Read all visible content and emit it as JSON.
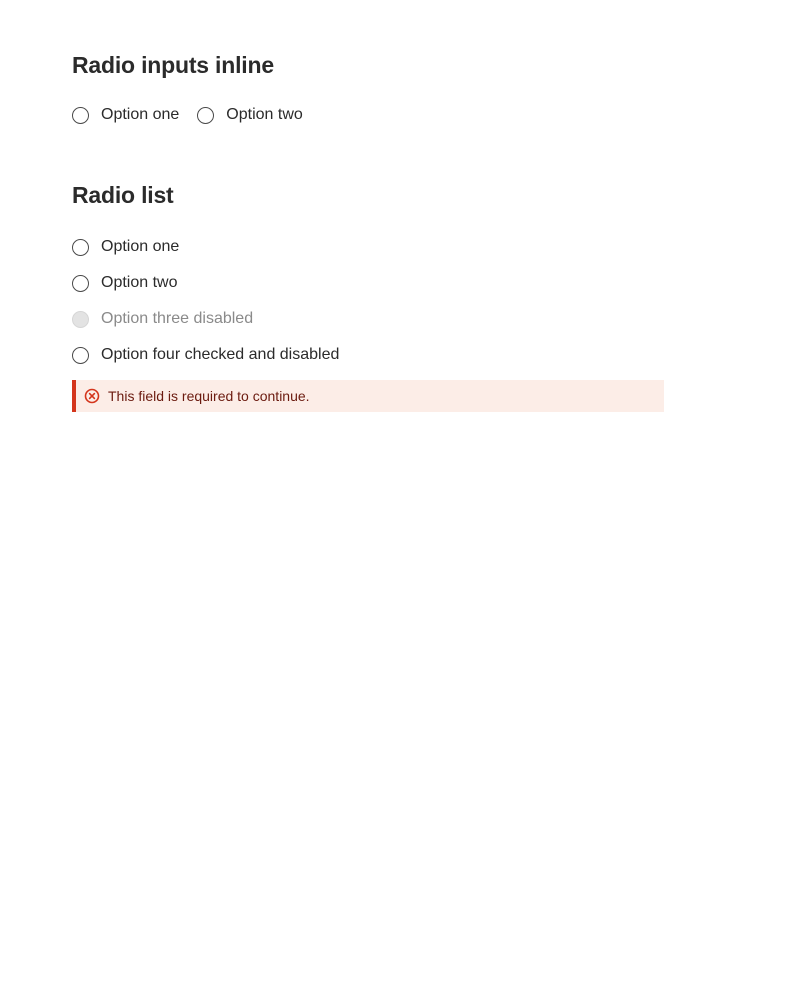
{
  "inline_section": {
    "heading": "Radio inputs inline",
    "options": [
      {
        "label": "Option one"
      },
      {
        "label": "Option two"
      }
    ]
  },
  "list_section": {
    "heading": "Radio list",
    "options": [
      {
        "label": "Option one",
        "disabled": false
      },
      {
        "label": "Option two",
        "disabled": false
      },
      {
        "label": "Option three disabled",
        "disabled": true
      },
      {
        "label": "Option four checked and disabled",
        "disabled": false
      }
    ]
  },
  "error": {
    "message": "This field is required to continue.",
    "icon": "error-circle-x-icon",
    "color": "#d4351c",
    "background": "#fcede7"
  }
}
